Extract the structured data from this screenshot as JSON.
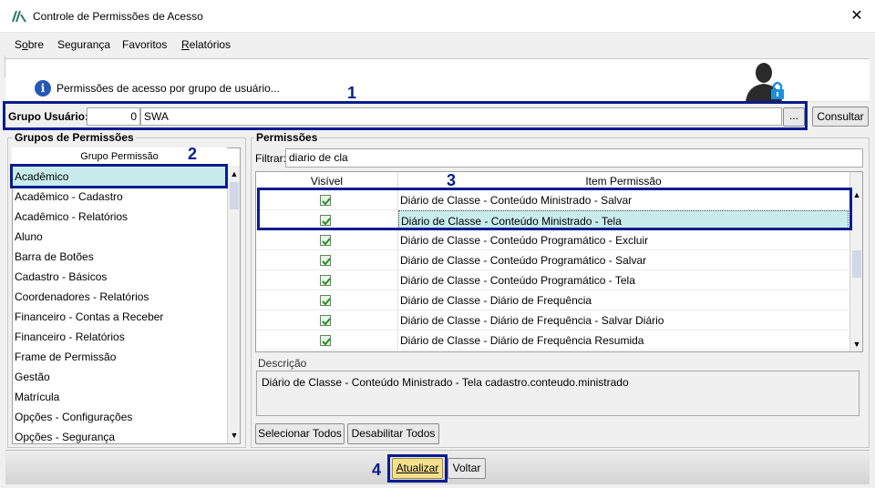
{
  "window": {
    "title": "Controle de Permissões de Acesso",
    "close_glyph": "✕"
  },
  "menu": [
    {
      "label": "Sobre",
      "mnemonic": "o"
    },
    {
      "label": "Segurança",
      "mnemonic": ""
    },
    {
      "label": "Favoritos",
      "mnemonic": ""
    },
    {
      "label": "Relatórios",
      "mnemonic": "R"
    }
  ],
  "header": {
    "info_glyph": "i",
    "text": "Permissões de acesso por grupo de usuário..."
  },
  "grupo_usuario": {
    "label": "Grupo Usuário:",
    "code": "0",
    "name": "SWA",
    "lookup_label": "...",
    "consultar_label": "Consultar"
  },
  "grupos_permissoes": {
    "title": "Grupos de Permissões",
    "column_header": "Grupo Permissão",
    "items": [
      "Acadêmico",
      "Acadêmico - Cadastro",
      "Acadêmico - Relatórios",
      "Aluno",
      "Barra de Botões",
      "Cadastro - Básicos",
      "Coordenadores - Relatórios",
      "Financeiro - Contas a Receber",
      "Financeiro - Relatórios",
      "Frame de Permissão",
      "Gestão",
      "Matrícula",
      "Opções - Configurações",
      "Opções - Segurança"
    ],
    "selected_index": 0
  },
  "permissoes": {
    "title": "Permissões",
    "filter_label": "Filtrar:",
    "filter_value": "diario de cla",
    "columns": [
      "Visível",
      "Item Permissão"
    ],
    "rows": [
      {
        "visible": true,
        "item": "Diário de Classe - Conteúdo Ministrado - Salvar"
      },
      {
        "visible": true,
        "item": "Diário de Classe - Conteúdo Ministrado - Tela"
      },
      {
        "visible": true,
        "item": "Diário de Classe - Conteúdo Programático - Excluir"
      },
      {
        "visible": true,
        "item": "Diário de Classe - Conteúdo Programático - Salvar"
      },
      {
        "visible": true,
        "item": "Diário de Classe - Conteúdo Programático - Tela"
      },
      {
        "visible": true,
        "item": "Diário de Classe - Diário de Frequência"
      },
      {
        "visible": true,
        "item": "Diário de Classe - Diário de Frequência - Salvar Diário"
      },
      {
        "visible": true,
        "item": "Diário de Classe - Diário de Frequência Resumida"
      }
    ],
    "selected_index": 1,
    "descricao_label": "Descrição",
    "descricao_text": "Diário de Classe - Conteúdo Ministrado - Tela cadastro.conteudo.ministrado",
    "selecionar_todos": "Selecionar Todos",
    "desabilitar_todos": "Desabilitar Todos"
  },
  "footer": {
    "atualizar": "Atualizar",
    "voltar": "Voltar"
  },
  "annotations": [
    "1",
    "2",
    "3",
    "4"
  ],
  "colors": {
    "annotation": "#0a1c8c",
    "selection": "#c8ecec",
    "primary_button": "#f4e08c",
    "info_icon": "#2558b8",
    "lock_icon": "#1e90d8"
  }
}
